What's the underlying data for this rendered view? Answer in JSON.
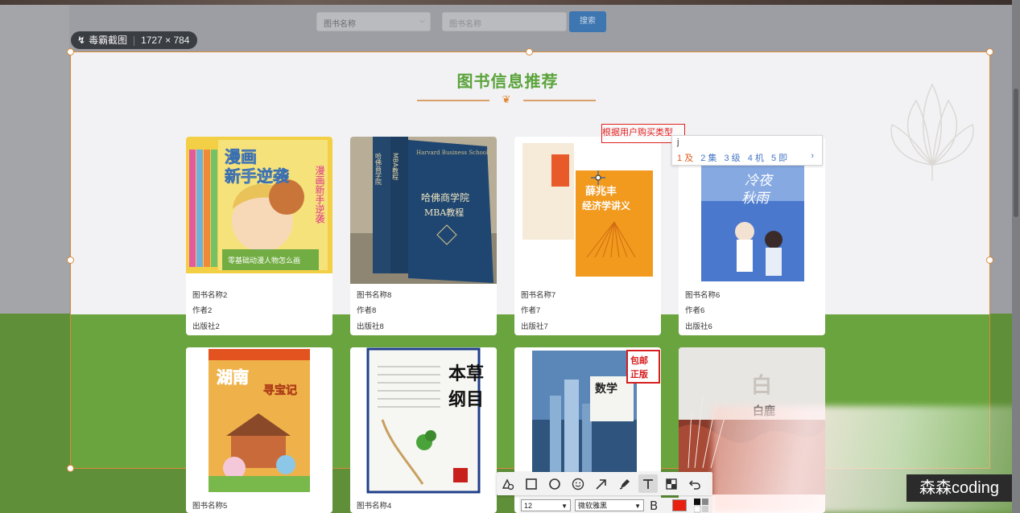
{
  "search": {
    "select_value": "图书名称",
    "input_placeholder": "图书名称",
    "button_label": "搜索"
  },
  "capture_tool": {
    "name": "毒霸截图",
    "dimensions": "1727 × 784",
    "selection_color": "#d98a3a"
  },
  "section": {
    "title": "图书信息推荐",
    "title_color": "#5aa33a"
  },
  "books": [
    {
      "name": "图书名称2",
      "author": "作者2",
      "publisher": "出版社2",
      "cover_title": "漫画新手逆袭",
      "cover_sub": "零基础动漫人物怎么画",
      "cover_color": "#f1c63a"
    },
    {
      "name": "图书名称8",
      "author": "作者8",
      "publisher": "出版社8",
      "cover_title": "哈佛商学院MBA教程",
      "cover_sub": "Harvard Business School",
      "cover_color": "#1f3f66"
    },
    {
      "name": "图书名称7",
      "author": "作者7",
      "publisher": "出版社7",
      "cover_title": "薛兆丰经济学讲义",
      "cover_sub": "经济学",
      "cover_color": "#f19a1e"
    },
    {
      "name": "图书名称6",
      "author": "作者6",
      "publisher": "出版社6",
      "cover_title": "冷夜秋雨",
      "cover_sub": "",
      "cover_color": "#3a66c2"
    },
    {
      "name": "图书名称5",
      "cover_title": "湖南寻宝记",
      "cover_color": "#e8a93a"
    },
    {
      "name": "图书名称4",
      "cover_title": "本草纲目",
      "cover_color": "#f4f4f0"
    },
    {
      "name": "",
      "cover_title": "数学",
      "cover_sub": "包邮 正版",
      "cover_color": "#3f6e9e"
    },
    {
      "name": "",
      "cover_title": "白鹿",
      "cover_color": "#8a3a2a"
    }
  ],
  "annotation": {
    "text": "根据用户购买类型",
    "color": "#e02020"
  },
  "ime": {
    "composition": "j",
    "candidates": [
      "1 及",
      "2 集",
      "3 级",
      "4 机",
      "5 即"
    ],
    "more": "›"
  },
  "toolbar": {
    "tools": [
      "shape-tool",
      "rectangle-tool",
      "ellipse-tool",
      "emoji-tool",
      "arrow-tool",
      "pen-tool",
      "text-tool",
      "mosaic-tool",
      "undo-tool"
    ],
    "active_tool": "text-tool",
    "font_size": "12",
    "font_family": "微软雅黑",
    "bold_label": "B",
    "current_color": "#e8200f"
  },
  "watermark": "森森coding"
}
